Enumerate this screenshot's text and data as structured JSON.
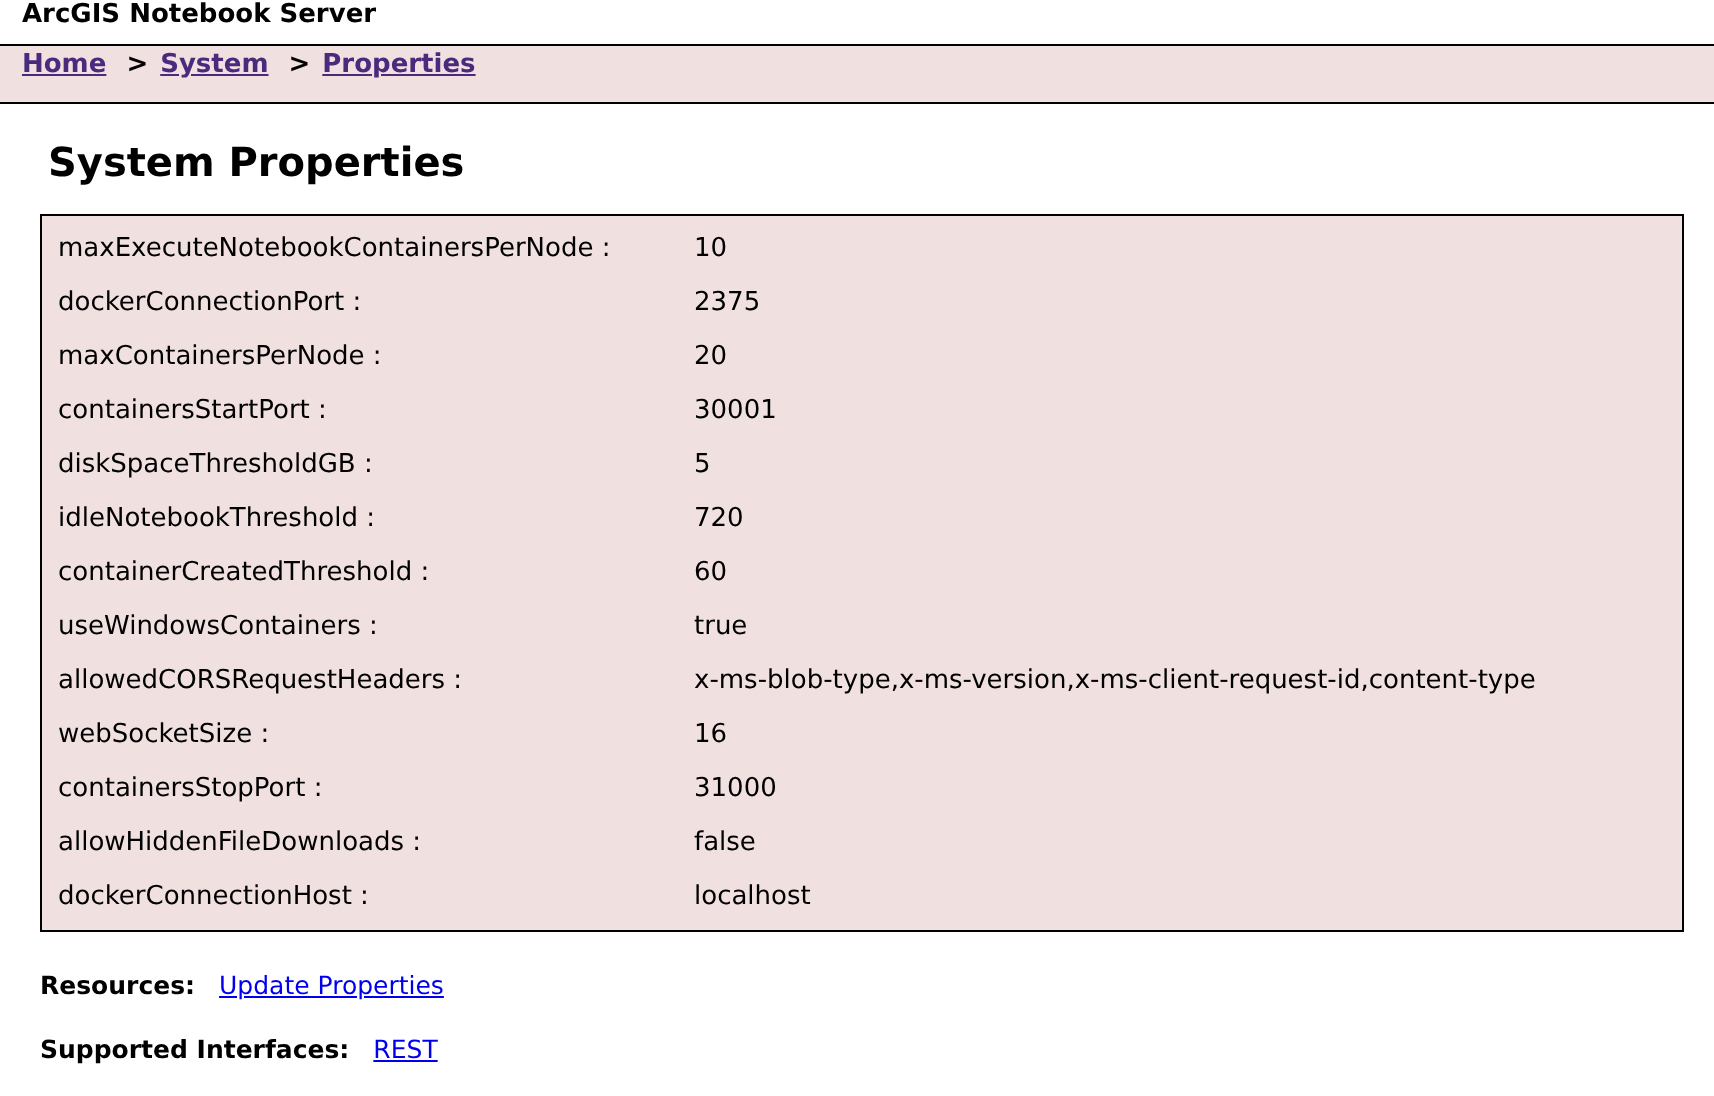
{
  "header": {
    "title": "ArcGIS Notebook Server"
  },
  "breadcrumb": [
    {
      "label": "Home"
    },
    {
      "separator": ">",
      "label": "System"
    },
    {
      "separator": ">",
      "label": "Properties"
    }
  ],
  "page_title": "System Properties",
  "properties": [
    {
      "name": "maxExecuteNotebookContainersPerNode :",
      "value": "10"
    },
    {
      "name": "dockerConnectionPort :",
      "value": "2375"
    },
    {
      "name": "maxContainersPerNode :",
      "value": "20"
    },
    {
      "name": "containersStartPort :",
      "value": "30001"
    },
    {
      "name": "diskSpaceThresholdGB :",
      "value": "5"
    },
    {
      "name": "idleNotebookThreshold :",
      "value": "720"
    },
    {
      "name": "containerCreatedThreshold :",
      "value": "60"
    },
    {
      "name": "useWindowsContainers :",
      "value": "true"
    },
    {
      "name": "allowedCORSRequestHeaders :",
      "value": "x-ms-blob-type,x-ms-version,x-ms-client-request-id,content-type"
    },
    {
      "name": "webSocketSize :",
      "value": "16"
    },
    {
      "name": "containersStopPort :",
      "value": "31000"
    },
    {
      "name": "allowHiddenFileDownloads :",
      "value": "false"
    },
    {
      "name": "dockerConnectionHost :",
      "value": "localhost"
    }
  ],
  "resources": {
    "label": "Resources:",
    "links": [
      "Update Properties"
    ]
  },
  "supported_interfaces": {
    "label": "Supported Interfaces:",
    "links": [
      "REST"
    ]
  }
}
